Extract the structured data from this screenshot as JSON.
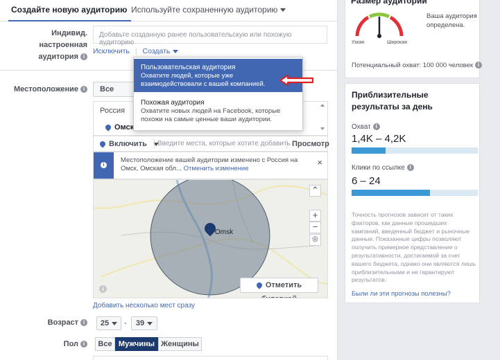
{
  "tabs": {
    "create": "Создайте новую аудиторию",
    "saved": "Используйте сохраненную аудиторию"
  },
  "custom_audience": {
    "label": "Индивид. настроенная аудитория",
    "placeholder": "Добавьте созданную ранее пользовательскую или похожую аудиторию",
    "exclude": "Исключить",
    "create": "Создать"
  },
  "create_menu": {
    "items": [
      {
        "title": "Пользовательская аудитория",
        "desc": "Охватите людей, которые уже взаимодействовали с вашей компанией."
      },
      {
        "title": "Похожая аудитория",
        "desc": "Охватите новых людей на Facebook, которые похожи на самые ценные ваши аудитории."
      }
    ]
  },
  "location": {
    "label": "Местоположение",
    "scope": "Все люди",
    "country": "Россия",
    "city": "Омск, ...",
    "include": "Включить",
    "input_placeholder": "Введите места, которые хотите добавить",
    "browse": "Просмотр",
    "notice": "Местоположение вашей аудитории изменено с Россия на Омск, Омская обл...",
    "notice_undo": "Отменить изменение",
    "map_city": "Omsk",
    "drop_pin": "Отметить булавкой",
    "add_bulk": "Добавить несколько мест сразу"
  },
  "age": {
    "label": "Возраст",
    "from": "25",
    "to": "39",
    "sep": "-"
  },
  "gender": {
    "label": "Пол",
    "options": [
      "Все",
      "Мужчины",
      "Женщины"
    ],
    "selected": "Мужчины"
  },
  "audience_size": {
    "title": "Размер аудитории",
    "status": "Ваша аудитория определена.",
    "narrow": "Узкая",
    "wide": "Широкая",
    "potential": "Потенциальный охват: 100 000 человек",
    "gauge_position": 0.5
  },
  "estimates": {
    "title": "Приблизительные результаты за день",
    "reach_label": "Охват",
    "reach_value": "1,4K – 4,2K",
    "reach_fill": 0.27,
    "clicks_label": "Клики по ссылке",
    "clicks_value": "6 – 24",
    "clicks_fill": 0.62,
    "note": "Точность прогнозов зависит от таких факторов, как данные прошедших кампаний, введенный бюджет и рыночные данные. Показанные цифры позволяют получить примерное представление о результативности, достигаемой за счет вашего бюджета, однако они являются лишь приблизительными и не гарантируют результатов.",
    "feedback": "Были ли эти прогнозы полезны?"
  },
  "colors": {
    "accent": "#4267b2",
    "highlight": "#4267b2",
    "bar": "#3b9ad6",
    "arrow": "#e02020"
  }
}
